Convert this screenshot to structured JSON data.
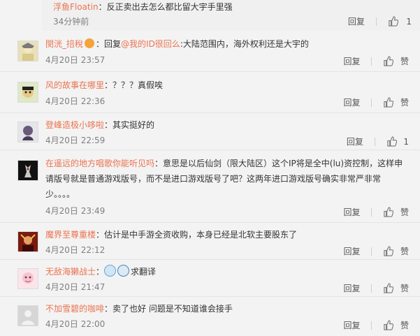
{
  "top_reply": {
    "name": "浮鱼Floatin",
    "text": "：反正卖出去怎么都比留大宇手里强",
    "time": "34分钟前",
    "reply_label": "回复",
    "like_count": "1"
  },
  "comments": [
    {
      "name": "閔洸_掊稅",
      "has_badge": true,
      "prefix": "：回复",
      "mention": "@我的ID很回么",
      "text": ":大陆范围内，海外权利还是大宇的",
      "date": "4月20日 23:57",
      "reply_label": "回复",
      "like_label": "赞"
    },
    {
      "name": "风的故事在哪里",
      "text": "：？？？真假唉",
      "date": "4月20日 22:36",
      "reply_label": "回复",
      "like_label": "赞"
    },
    {
      "name": "登峰造极小哆啦",
      "text": "：其实挺好的",
      "date": "4月20日 22:59",
      "reply_label": "回复",
      "like_label": "1"
    },
    {
      "name": "在遥远的地方唱歌你能听见吗",
      "text": "：意思是以后仙剑（限大陆区）这个IP将是全中(lu)资控制，这样申请版号就是普通游戏版号，而不是进口游戏版号了吧？这两年进口游戏版号确实非常严非常少。。。。",
      "date": "4月20日 23:49",
      "reply_label": "回复",
      "like_label": "赞"
    },
    {
      "name": "魔界至尊重楼",
      "text": "：估计是中手游全资收购，本身已经是北软主要股东了",
      "date": "4月20日 22:12",
      "reply_label": "回复",
      "like_label": "赞"
    },
    {
      "name": "无敌海獭战士",
      "text": "：",
      "text2": "求翻译",
      "date": "4月20日 21:47",
      "reply_label": "回复",
      "like_label": "赞"
    },
    {
      "name": "不加雪碧的咖啡",
      "text": "：卖了也好  问题是不知道谁会接手",
      "date": "4月20日 22:00",
      "reply_label": "回复",
      "like_label": "赞"
    }
  ],
  "colors": {
    "username": "#eb7350",
    "meta": "#808080",
    "text": "#333333"
  }
}
